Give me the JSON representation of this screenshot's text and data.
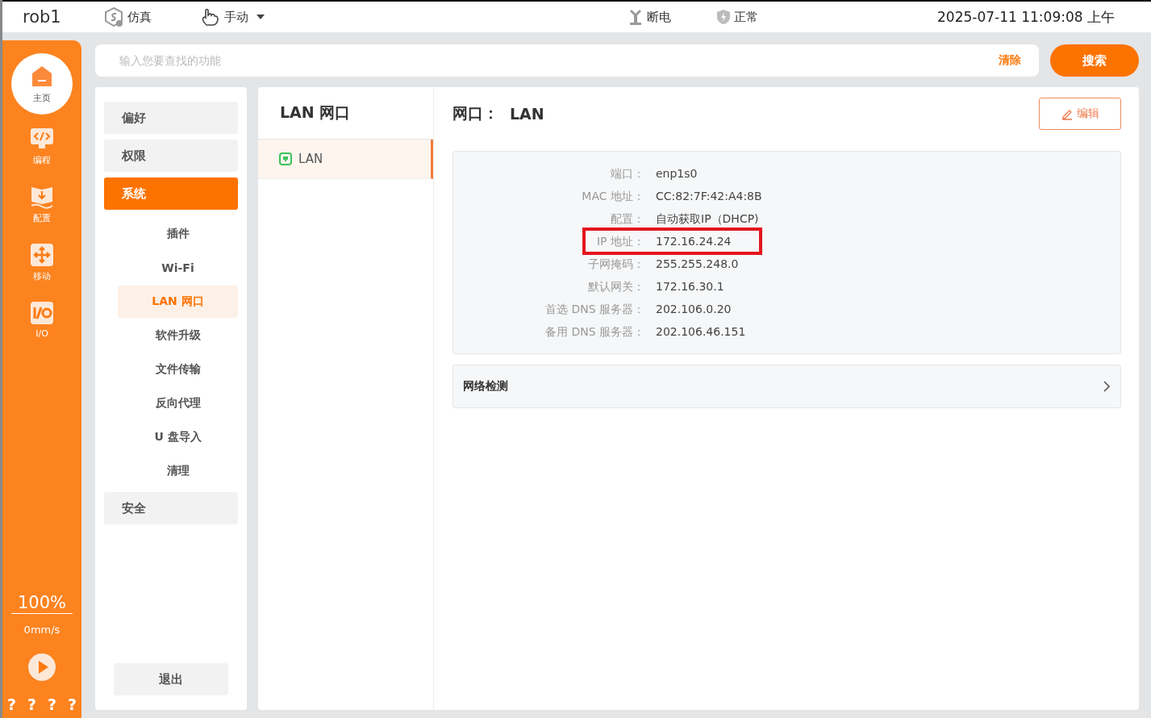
{
  "top_bar": {
    "robot": "rob1",
    "mode": "仿真",
    "control": "手动",
    "power": "断电",
    "safety": "正常",
    "datetime": "2025-07-11 11:09:08 上午"
  },
  "nav": {
    "items": [
      {
        "kind": "home",
        "label": "主页",
        "selected": true
      },
      {
        "kind": "code",
        "label": "编程",
        "selected": false
      },
      {
        "kind": "config",
        "label": "配置",
        "selected": false
      },
      {
        "kind": "move",
        "label": "移动",
        "selected": false
      },
      {
        "kind": "io",
        "label": "I/O",
        "selected": false
      }
    ],
    "speed_percent": "100%",
    "speed": "0mm/s",
    "status_marks": [
      "?",
      "?",
      "?",
      "?"
    ]
  },
  "search": {
    "placeholder": "输入您要查找的功能",
    "clear": "清除",
    "button": "搜索"
  },
  "settings_menu": {
    "items": [
      {
        "label": "偏好",
        "selected": false
      },
      {
        "label": "权限",
        "selected": false
      },
      {
        "label": "系统",
        "selected": true,
        "children": [
          {
            "label": "插件",
            "selected": false
          },
          {
            "label": "Wi-Fi",
            "selected": false
          },
          {
            "label": "LAN 网口",
            "selected": true
          },
          {
            "label": "软件升级",
            "selected": false
          },
          {
            "label": "文件传输",
            "selected": false
          },
          {
            "label": "反向代理",
            "selected": false
          },
          {
            "label": "U 盘导入",
            "selected": false
          },
          {
            "label": "清理",
            "selected": false
          }
        ]
      },
      {
        "label": "安全",
        "selected": false
      }
    ],
    "exit": "退出"
  },
  "lan_list": {
    "title": "LAN 网口",
    "items": [
      {
        "label": "LAN",
        "selected": true
      }
    ]
  },
  "detail": {
    "title": "网口：",
    "name": "LAN",
    "edit": "编辑",
    "fields": [
      {
        "label": "端口：",
        "value": "enp1s0",
        "highlighted": false
      },
      {
        "label": "MAC 地址：",
        "value": "CC:82:7F:42:A4:8B",
        "highlighted": false
      },
      {
        "label": "配置：",
        "value": "自动获取IP（DHCP)",
        "highlighted": false
      },
      {
        "label": "IP 地址：",
        "value": "172.16.24.24",
        "highlighted": true
      },
      {
        "label": "子网掩码：",
        "value": "255.255.248.0",
        "highlighted": false
      },
      {
        "label": "默认网关：",
        "value": "172.16.30.1",
        "highlighted": false
      },
      {
        "label": "首选 DNS 服务器：",
        "value": "202.106.0.20",
        "highlighted": false
      },
      {
        "label": "备用 DNS 服务器：",
        "value": "202.106.46.151",
        "highlighted": false
      }
    ],
    "network_check": "网络检测"
  }
}
